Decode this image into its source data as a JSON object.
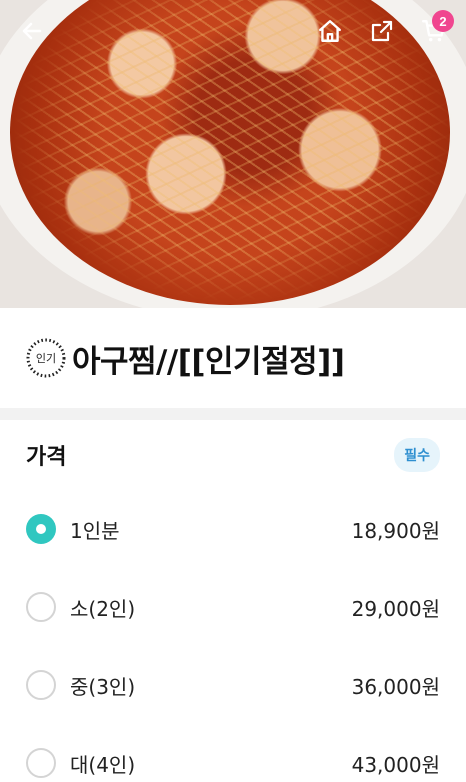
{
  "header": {
    "back_icon": "arrow-left-icon",
    "home_icon": "home-icon",
    "share_icon": "share-icon",
    "cart_icon": "cart-icon",
    "cart_count": "2"
  },
  "hero": {
    "description_icon": "food-photo"
  },
  "menu": {
    "badge_label": "인기",
    "title": "아구찜//[[인기절정]]"
  },
  "price_section": {
    "title": "가격",
    "required_label": "필수",
    "options": [
      {
        "label": "1인분",
        "price": "18,900원",
        "selected": true
      },
      {
        "label": "소(2인)",
        "price": "29,000원",
        "selected": false
      },
      {
        "label": "중(3인)",
        "price": "36,000원",
        "selected": false
      },
      {
        "label": "대(4인)",
        "price": "43,000원",
        "selected": false
      }
    ]
  },
  "colors": {
    "accent": "#30c7c0",
    "badge": "#f0458f",
    "required_bg": "#e6f4fb",
    "required_text": "#2e8fd0"
  }
}
